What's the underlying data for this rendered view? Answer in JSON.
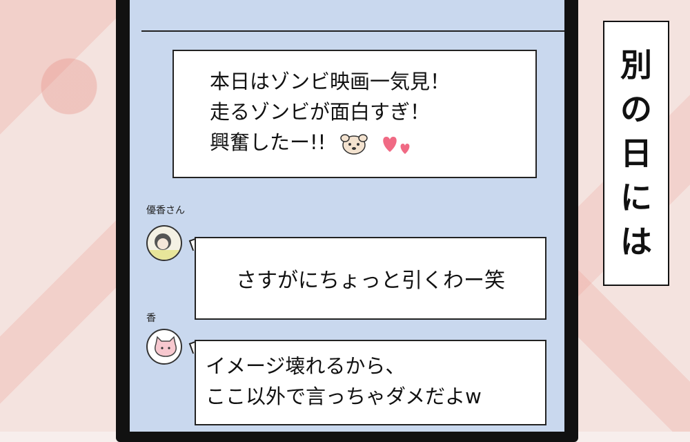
{
  "post": {
    "lines": [
      "本日はゾンビ映画一気見！",
      "走るゾンビが面白すぎ！",
      "興奮したー!!"
    ]
  },
  "comments": [
    {
      "user": "優香さん",
      "text": "さすがにちょっと引くわー笑"
    },
    {
      "user": "香",
      "lines": [
        "イメージ壊れるから、",
        "ここ以外で言っちゃダメだよw"
      ]
    }
  ],
  "caption": {
    "chars": [
      "別",
      "の",
      "日",
      "に",
      "は"
    ]
  },
  "icons": {
    "post_emoji": "dog-face-icon",
    "post_hearts": "hearts-icon",
    "avatar1": "person-avatar-icon",
    "avatar2": "cat-avatar-icon"
  }
}
